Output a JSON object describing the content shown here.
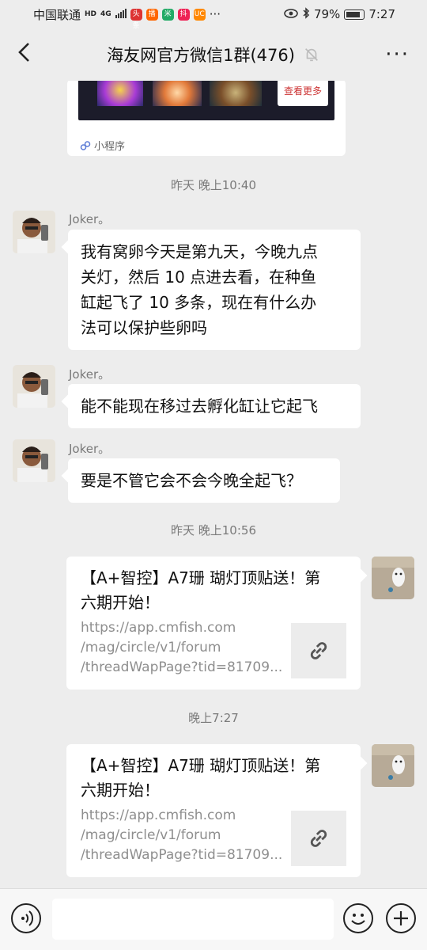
{
  "status_bar": {
    "carrier": "中国联通",
    "hd": "HD",
    "network": "4G",
    "app_badges": [
      "头条",
      "播",
      "米",
      "抖",
      "UC"
    ],
    "more": "···",
    "battery": "79%",
    "time": "7:27"
  },
  "header": {
    "back": "‹",
    "title": "海友网官方微信1群(476)",
    "more": "···"
  },
  "mini_program_card": {
    "more_label": "查看更多",
    "footer": "小程序"
  },
  "messages": [
    {
      "type": "timestamp",
      "text": "昨天 晚上10:40"
    },
    {
      "type": "text",
      "sender": "Joker。",
      "lines": [
        "我有窝卵今天是第九天，今晚九点",
        "关灯，然后 10 点进去看，在种鱼",
        "缸起飞了 10 多条，现在有什么办",
        "法可以保护些卵吗"
      ]
    },
    {
      "type": "text",
      "sender": "Joker。",
      "lines": [
        "能不能现在移过去孵化缸让它起飞"
      ]
    },
    {
      "type": "text",
      "sender": "Joker。",
      "lines": [
        "要是不管它会不会今晚全起飞？"
      ]
    },
    {
      "type": "timestamp",
      "text": "昨天 晚上10:56"
    },
    {
      "type": "link",
      "title_lines": [
        "【A+智控】A7珊 瑚灯顶贴送！第",
        "六期开始！"
      ],
      "url_lines": [
        "https://app.cmfish.com",
        "/mag/circle/v1/forum",
        "/threadWapPage?tid=81709..."
      ]
    },
    {
      "type": "timestamp",
      "text": "晚上7:27"
    },
    {
      "type": "link",
      "title_lines": [
        "【A+智控】A7珊 瑚灯顶贴送！第",
        "六期开始！"
      ],
      "url_lines": [
        "https://app.cmfish.com",
        "/mag/circle/v1/forum",
        "/threadWapPage?tid=81709..."
      ]
    }
  ],
  "icons": {
    "voice": "voice-icon",
    "emoji": "emoji-icon",
    "plus": "plus-icon",
    "link": "link-icon",
    "mute": "muted-bell-icon"
  },
  "colors": {
    "background": "#ededed",
    "bubble": "#ffffff",
    "timestamp": "#7a7a7a",
    "link_url": "#8e8e8e"
  }
}
